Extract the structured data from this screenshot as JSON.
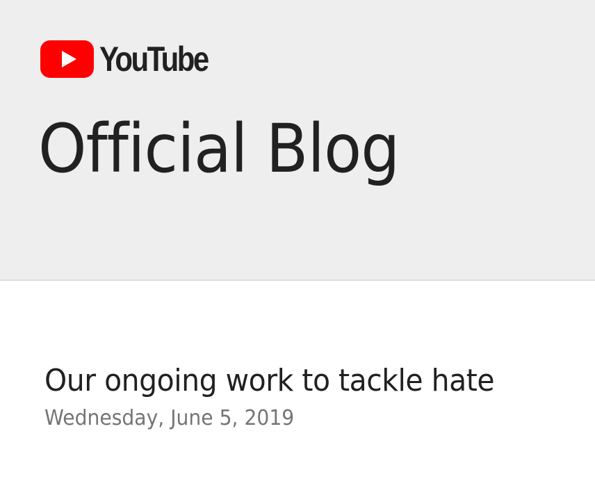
{
  "header": {
    "logo_text": "YouTube",
    "logo_icon": "youtube-play-icon",
    "blog_title": "Official Blog",
    "background": "#eeeeee"
  },
  "post": {
    "title": "Our ongoing work to tackle hate",
    "date": "Wednesday, June 5, 2019"
  },
  "colors": {
    "brand_red": "#ff0000",
    "text_primary": "#212121",
    "text_secondary": "#757575"
  }
}
